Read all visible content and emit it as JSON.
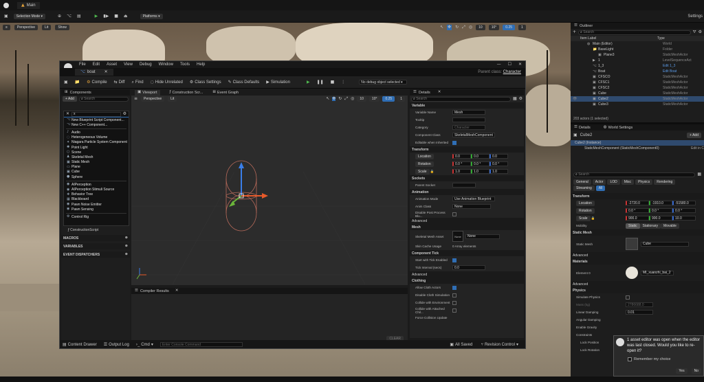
{
  "window": {
    "tab": "Main",
    "selection_mode": "Selection Mode",
    "platforms": "Platforms",
    "settings": "Settings"
  },
  "viewport_main": {
    "perspective": "Perspective",
    "lit": "Lit",
    "show": "Show",
    "grid": "10",
    "angle": "10°",
    "scale": "0.25",
    "cam": "1"
  },
  "outliner": {
    "title": "Outliner",
    "search_placeholder": "Search",
    "col_label": "Item Label",
    "col_type": "Type",
    "rows": [
      {
        "label": "Main (Editor)",
        "type": "World"
      },
      {
        "label": "BaseLight",
        "type": "Folder"
      },
      {
        "label": "Plane3",
        "type": "StaticMeshActor"
      },
      {
        "label": "1",
        "type": "LevelSequenceAct"
      },
      {
        "label": "1_3",
        "type": "Edit 1_3"
      },
      {
        "label": "Boat",
        "type": "Edit Boat"
      },
      {
        "label": "CFSCO",
        "type": "StaticMeshActor"
      },
      {
        "label": "CFSC1",
        "type": "StaticMeshActor"
      },
      {
        "label": "CFSC2",
        "type": "StaticMeshActor"
      },
      {
        "label": "Cube",
        "type": "StaticMeshActor"
      },
      {
        "label": "Cube2",
        "type": "StaticMeshActor"
      },
      {
        "label": "Cube3",
        "type": "StaticMeshActor"
      }
    ],
    "footer": "203 actors (1 selected)"
  },
  "details_right": {
    "tab1": "Details",
    "tab2": "World Settings",
    "actor": "Cube2",
    "add": "+ Add",
    "instance": "Cube2 (Instance)",
    "component": "StaticMeshComponent (StaticMeshComponent0)",
    "component_edit": "Edit in C",
    "search": "Search",
    "filters": [
      "General",
      "Actor",
      "LOD",
      "Misc",
      "Physics",
      "Rendering"
    ],
    "streaming": "Streaming",
    "all": "All",
    "transform": "Transform",
    "location": "Location",
    "rotation": "Rotation",
    "scale": "Scale",
    "loc_vals": [
      "-2720.0",
      "-1910.0",
      "-51580.0"
    ],
    "rot_vals": [
      "0.0 °",
      "0.0 °",
      "0.0 °"
    ],
    "scale_vals": [
      "900.0",
      "900.0",
      "10.0"
    ],
    "mobility": "Mobility",
    "mob_opts": [
      "Static",
      "Stationary",
      "Movable"
    ],
    "static_mesh_sec": "Static Mesh",
    "static_mesh": "Static Mesh",
    "mesh_value": "Cube",
    "advanced": "Advanced",
    "materials": "Materials",
    "element0": "Element 0",
    "material_value": "MI_xuanzhi_bai_2",
    "physics": "Physics",
    "simulate": "Simulate Physics",
    "mass": "Mass (kg)",
    "mass_val": "2786688.0",
    "linear_damping": "Linear Damping",
    "linear_val": "0.01",
    "angular_damping": "Angular Damping",
    "gravity": "Enable Gravity",
    "constraints": "Constraints",
    "lock_pos": "Lock Position",
    "lock_rot": "Lock Rotation"
  },
  "popup": {
    "text": "1 asset editor was open when the editor was last closed. Would you like to re-open it?",
    "remember": "Remember my choice",
    "yes": "Yes",
    "no": "No"
  },
  "bp": {
    "menu": [
      "File",
      "Edit",
      "Asset",
      "View",
      "Debug",
      "Window",
      "Tools",
      "Help"
    ],
    "tab": "boat",
    "parent_class_label": "Parent class:",
    "parent_class": "Character",
    "tools": [
      "Compile",
      "Diff",
      "Find",
      "Hide Unrelated",
      "Class Settings",
      "Class Defaults",
      "Simulation"
    ],
    "debug": "No debug object selected",
    "components_tab": "Components",
    "add": "+ Add",
    "search": "Search",
    "search_value": "x",
    "dropdown": [
      "New Blueprint Script Component...",
      "New C++ Component...",
      "Audio",
      "Heterogeneous Volume",
      "Niagara Particle System Component",
      "Point Light",
      "Scene",
      "Skeletal Mesh",
      "Static Mesh",
      "Plane",
      "Cube",
      "Sphere",
      "AIPerception",
      "AIPerception Stimuli Source",
      "Behavior Tree",
      "Blackboard",
      "Pawn Noise Emitter",
      "Pawn Sensing",
      "Control Rig"
    ],
    "construction_script": "ConstructionScript",
    "macros": "MACROS",
    "variables": "VARIABLES",
    "dispatchers": "EVENT DISPATCHERS",
    "vp_tabs": [
      "Viewport",
      "Construction Scr...",
      "Event Graph"
    ],
    "vp_persp": "Perspective",
    "vp_lit": "Lit",
    "vp_grid": "10",
    "vp_angle": "10°",
    "vp_scale": "0.25",
    "vp_cam": "1",
    "compiler": "Compiler Results",
    "clear": "CLEAR",
    "details_tab": "Details",
    "details_search": "Search",
    "variable_sec": "Variable",
    "variable_name": "Variable Name",
    "variable_name_val": "Mesh",
    "tooltip": "Tooltip",
    "category": "Category",
    "category_val": "Character",
    "component_class": "Component Class",
    "component_class_val": "SkeletalMeshComponent",
    "editable_inherited": "Editable when Inherited",
    "transform_sec": "Transform",
    "location": "Location",
    "rotation": "Rotation",
    "scale": "Scale",
    "loc": [
      "0.0",
      "0.0",
      "0.0"
    ],
    "rot": [
      "0.0 °",
      "0.0 °",
      "0.0 °"
    ],
    "scl": [
      "1.0",
      "1.0",
      "1.0"
    ],
    "sockets_sec": "Sockets",
    "parent_socket": "Parent Socket",
    "animation_sec": "Animation",
    "anim_mode": "Animation Mode",
    "anim_mode_val": "Use Animation Blueprint",
    "anim_class": "Anim Class",
    "anim_class_val": "None",
    "disable_post": "Disable Post Process Blu...",
    "advanced": "Advanced",
    "mesh_sec": "Mesh",
    "skeletal_mesh_asset": "Skeletal Mesh Asset",
    "none": "None",
    "skin_cache": "Skin Cache Usage",
    "skin_cache_val": "0 Array elements",
    "tick_sec": "Component Tick",
    "start_tick": "Start with Tick Enabled",
    "tick_interval": "Tick Interval (secs)",
    "tick_val": "0.0",
    "clothing_sec": "Clothing",
    "allow_cloth": "Allow Cloth Actors",
    "disable_cloth": "Disable Cloth Simulation",
    "collide_env": "Collide with Environment",
    "collide_attached": "Collide with Attached Chil...",
    "force_update": "Force Collision Update",
    "content_drawer": "Content Drawer",
    "output_log": "Output Log",
    "cmd": "Cmd",
    "console_placeholder": "Enter Console Command",
    "all_saved": "All Saved",
    "revision": "Revision Control"
  },
  "colors": {
    "accent": "#2f6eb5",
    "selected": "#2f4a6e",
    "panel": "#1d1d1d",
    "play": "#4fb84f"
  }
}
